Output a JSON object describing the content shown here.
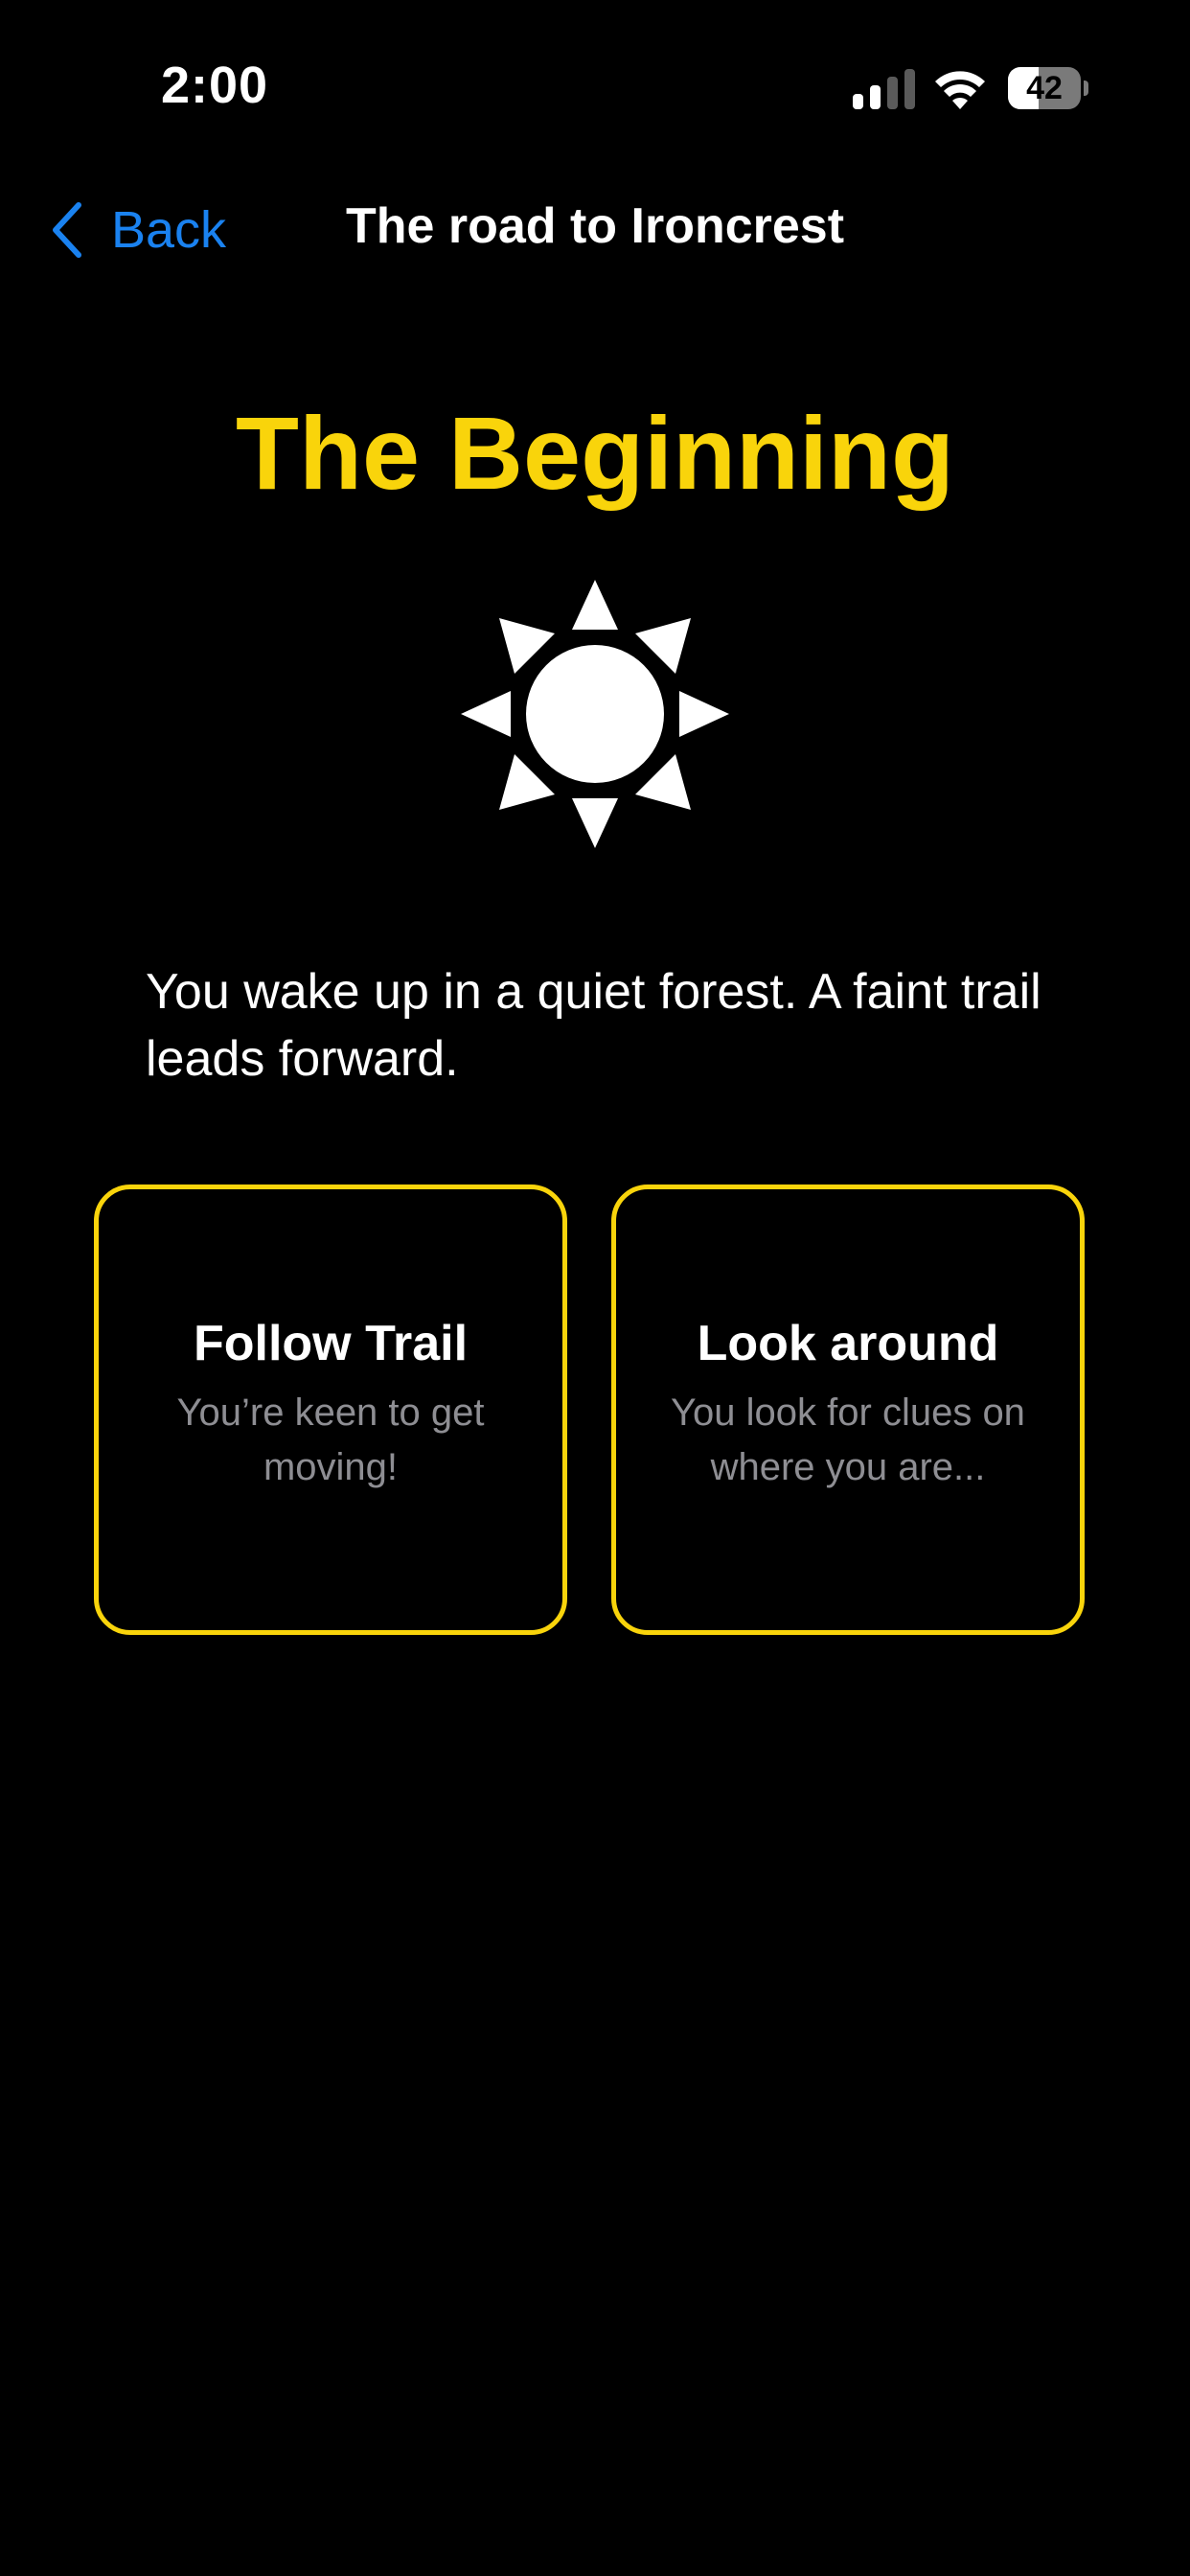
{
  "status_bar": {
    "time": "2:00",
    "battery_level": "42",
    "battery_fraction": 0.42,
    "signal_icon": "cellular-signal-icon",
    "wifi_icon": "wifi-icon",
    "battery_icon": "battery-icon"
  },
  "nav": {
    "back_label": "Back",
    "back_icon": "chevron-left-icon",
    "title": "The road to Ironcrest"
  },
  "scene": {
    "title": "The Beginning",
    "icon": "sun-icon",
    "text": "You wake up in a quiet forest. A faint trail leads forward."
  },
  "choices": [
    {
      "title": "Follow Trail",
      "description": "You’re keen to get moving!"
    },
    {
      "title": "Look around",
      "description": "You look for clues on where you are..."
    }
  ],
  "colors": {
    "accent": "#f9d40b",
    "link": "#1a82f0",
    "background": "#000000",
    "secondary_text": "#8e8e93"
  }
}
